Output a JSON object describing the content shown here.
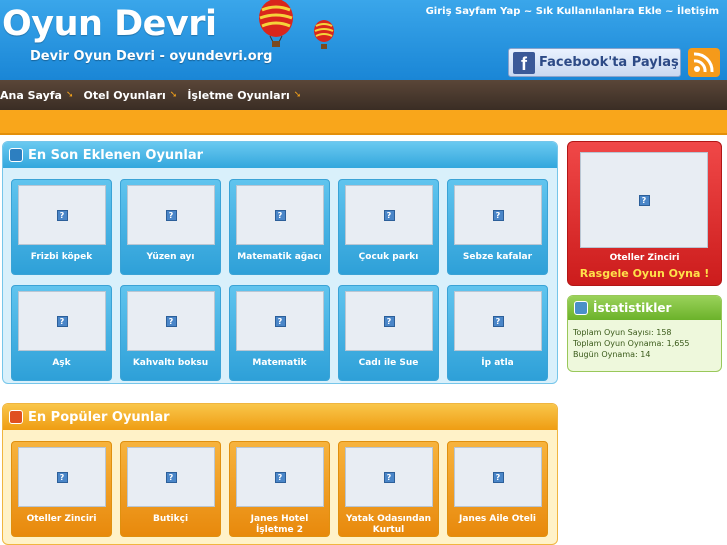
{
  "header": {
    "logo": "Oyun Devri",
    "tagline": "Devir Oyun Devri - oyundevri.org",
    "links": [
      "Giriş Sayfam Yap",
      "Sık Kullanılanlara Ekle",
      "İletişim"
    ],
    "separator": " ~ ",
    "facebook_label": "Facebook'ta Paylaş",
    "facebook_icon": "f"
  },
  "nav": {
    "items": [
      "Ana Sayfa",
      "Otel Oyunları",
      "İşletme Oyunları"
    ],
    "arrow": "➘"
  },
  "latest": {
    "title": "En Son Eklenen Oyunlar",
    "games": [
      "Frizbi köpek",
      "Yüzen ayı",
      "Matematik ağacı",
      "Çocuk parkı",
      "Sebze kafalar",
      "Aşk",
      "Kahvaltı boksu",
      "Matematik",
      "Cadı ile Sue",
      "İp atla"
    ]
  },
  "popular": {
    "title": "En Popüler Oyunlar",
    "games": [
      "Oteller Zinciri",
      "Butikçi",
      "Janes Hotel İşletme 2",
      "Yatak Odasından Kurtul",
      "Janes Aile Oteli"
    ]
  },
  "random": {
    "game": "Oteller Zinciri",
    "button": "Rasgele Oyun Oyna !"
  },
  "stats": {
    "title": "İstatistikler",
    "rows": [
      "Toplam Oyun Sayısı: 158",
      "Toplam Oyun Oynama: 1,655",
      "Bugün Oynama: 14"
    ]
  },
  "placeholder_glyph": "?",
  "colors": {
    "header_blue": "#1a86d6",
    "nav_brown": "#3a2d24",
    "accent_orange": "#f9a61b",
    "panel_blue": "#33a7dd",
    "random_red": "#cc1c1c",
    "stats_green": "#6bb22a"
  }
}
